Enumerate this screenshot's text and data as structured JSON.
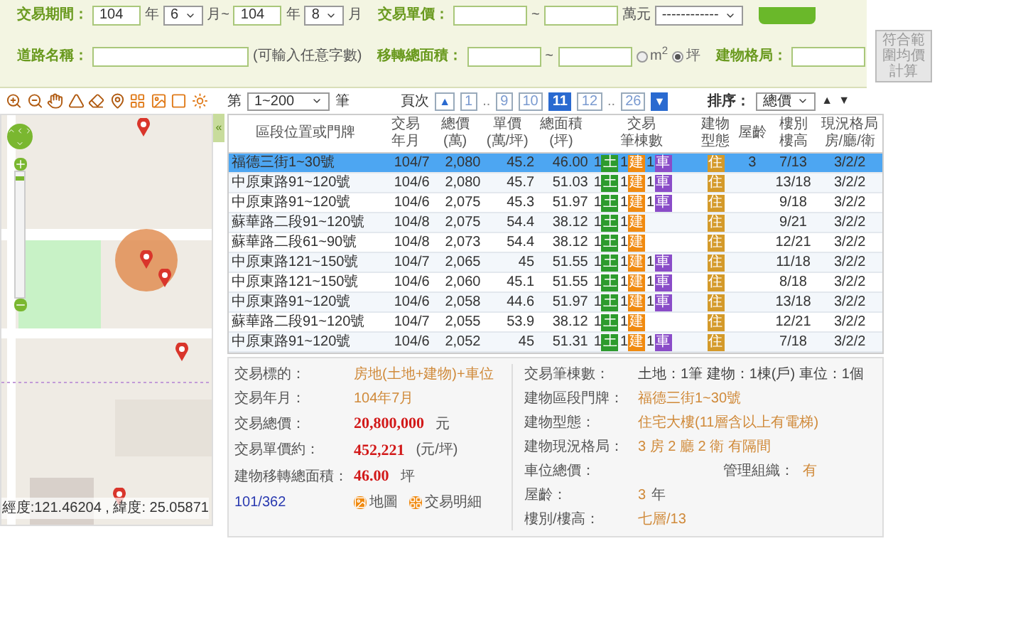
{
  "filters": {
    "trade_period": [
      {
        "kind": "label",
        "text": "交易期間："
      },
      {
        "kind": "short",
        "value": "104"
      },
      {
        "kind": "text",
        "text": "年"
      },
      {
        "kind": "select",
        "value": "6"
      },
      {
        "kind": "text",
        "text": "月~"
      },
      {
        "kind": "short",
        "value": "104"
      },
      {
        "kind": "text",
        "text": "年"
      },
      {
        "kind": "select",
        "value": "8"
      },
      {
        "kind": "text",
        "text": "月"
      }
    ],
    "unit_price": [
      {
        "kind": "label",
        "text": "交易單價："
      },
      {
        "kind": "field"
      },
      {
        "kind": "text",
        "text": "~"
      },
      {
        "kind": "field"
      },
      {
        "kind": "text",
        "text": "萬元"
      },
      {
        "kind": "select",
        "value": "------------"
      }
    ],
    "road_name": [
      {
        "kind": "label",
        "text": "道路名稱："
      },
      {
        "kind": "wide"
      },
      {
        "kind": "text",
        "text": "(可輸入任意字數)"
      }
    ],
    "total_area": [
      {
        "kind": "label",
        "text": "移轉總面積："
      },
      {
        "kind": "field"
      },
      {
        "kind": "text",
        "text": "~"
      },
      {
        "kind": "field"
      },
      {
        "kind": "radio",
        "text": "m$^{2}$",
        "selected": false
      },
      {
        "kind": "radio",
        "text": "坪",
        "selected": true
      }
    ],
    "layout": [
      {
        "kind": "label",
        "text": "建物格局："
      },
      {
        "kind": "field"
      },
      {
        "kind": "button",
        "text": "符合範圍均價計算"
      }
    ]
  },
  "pager": {
    "prefix": "第",
    "range": "1~200",
    "suffix": "筆",
    "page_label": "頁次",
    "prev": "▲",
    "next": "▼",
    "pages": [
      {
        "label": "1",
        "kind": "page",
        "selected": false
      },
      {
        "label": "..",
        "kind": "gap"
      },
      {
        "label": "9",
        "kind": "page",
        "selected": false
      },
      {
        "label": "10",
        "kind": "page",
        "selected": false
      },
      {
        "label": "11",
        "kind": "page",
        "selected": true
      },
      {
        "label": "12",
        "kind": "page",
        "selected": false
      },
      {
        "label": "..",
        "kind": "gap"
      },
      {
        "label": "26",
        "kind": "page",
        "selected": false
      }
    ],
    "sort_label": "排序：",
    "sort_value": "總價",
    "asc": "▲",
    "desc": "▼"
  },
  "collapse": "«",
  "map": {
    "zoom": {
      "level": 0.97
    },
    "coords": "經度:121.46204 , 緯度: 25.05871"
  },
  "table": {
    "columns": [
      [
        "區段位置或門牌"
      ],
      [
        "交易",
        "年月"
      ],
      [
        "總價",
        "(萬)"
      ],
      [
        "單價",
        "(萬/坪)"
      ],
      [
        "總面積",
        "(坪)"
      ],
      [
        "交易",
        "筆棟數"
      ],
      [
        "建物",
        "型態"
      ],
      [
        "屋齡"
      ],
      [
        "樓別",
        "樓高"
      ],
      [
        "現況格局",
        "房/廳/衛"
      ]
    ],
    "rows": [
      {
        "selected": true,
        "address": "福德三街1~30號",
        "date": "104/7",
        "total": "2,080",
        "price": "45.2",
        "area": "46.00",
        "counts": [
          {
            "kind": "land",
            "n": "1",
            "label": "土"
          },
          {
            "kind": "building",
            "n": "1",
            "label": "建"
          },
          {
            "kind": "parking",
            "n": "1",
            "label": "車"
          }
        ],
        "type": "住",
        "age": "3",
        "floor": "7/13",
        "layout": "3/2/2"
      },
      {
        "selected": false,
        "address": "中原東路91~120號",
        "date": "104/6",
        "total": "2,080",
        "price": "45.7",
        "area": "51.03",
        "counts": [
          {
            "kind": "land",
            "n": "1",
            "label": "土"
          },
          {
            "kind": "building",
            "n": "1",
            "label": "建"
          },
          {
            "kind": "parking",
            "n": "1",
            "label": "車"
          }
        ],
        "type": "住",
        "floor": "13/18",
        "layout": "3/2/2"
      },
      {
        "selected": false,
        "address": "中原東路91~120號",
        "date": "104/6",
        "total": "2,075",
        "price": "45.3",
        "area": "51.97",
        "counts": [
          {
            "kind": "land",
            "n": "1",
            "label": "土"
          },
          {
            "kind": "building",
            "n": "1",
            "label": "建"
          },
          {
            "kind": "parking",
            "n": "1",
            "label": "車"
          }
        ],
        "type": "住",
        "floor": "9/18",
        "layout": "3/2/2"
      },
      {
        "selected": false,
        "address": "蘇華路二段91~120號",
        "date": "104/8",
        "total": "2,075",
        "price": "54.4",
        "area": "38.12",
        "counts": [
          {
            "kind": "land",
            "n": "1",
            "label": "土"
          },
          {
            "kind": "building",
            "n": "1",
            "label": "建"
          }
        ],
        "type": "住",
        "floor": "9/21",
        "layout": "3/2/2"
      },
      {
        "selected": false,
        "address": "蘇華路二段61~90號",
        "date": "104/8",
        "total": "2,073",
        "price": "54.4",
        "area": "38.12",
        "counts": [
          {
            "kind": "land",
            "n": "1",
            "label": "土"
          },
          {
            "kind": "building",
            "n": "1",
            "label": "建"
          }
        ],
        "type": "住",
        "floor": "12/21",
        "layout": "3/2/2"
      },
      {
        "selected": false,
        "address": "中原東路121~150號",
        "date": "104/7",
        "total": "2,065",
        "price": "45",
        "area": "51.55",
        "counts": [
          {
            "kind": "land",
            "n": "1",
            "label": "土"
          },
          {
            "kind": "building",
            "n": "1",
            "label": "建"
          },
          {
            "kind": "parking",
            "n": "1",
            "label": "車"
          }
        ],
        "type": "住",
        "floor": "11/18",
        "layout": "3/2/2"
      },
      {
        "selected": false,
        "address": "中原東路121~150號",
        "date": "104/6",
        "total": "2,060",
        "price": "45.1",
        "area": "51.55",
        "counts": [
          {
            "kind": "land",
            "n": "1",
            "label": "土"
          },
          {
            "kind": "building",
            "n": "1",
            "label": "建"
          },
          {
            "kind": "parking",
            "n": "1",
            "label": "車"
          }
        ],
        "type": "住",
        "floor": "8/18",
        "layout": "3/2/2"
      },
      {
        "selected": false,
        "address": "中原東路91~120號",
        "date": "104/6",
        "total": "2,058",
        "price": "44.6",
        "area": "51.97",
        "counts": [
          {
            "kind": "land",
            "n": "1",
            "label": "土"
          },
          {
            "kind": "building",
            "n": "1",
            "label": "建"
          },
          {
            "kind": "parking",
            "n": "1",
            "label": "車"
          }
        ],
        "type": "住",
        "floor": "13/18",
        "layout": "3/2/2"
      },
      {
        "selected": false,
        "address": "蘇華路二段91~120號",
        "date": "104/7",
        "total": "2,055",
        "price": "53.9",
        "area": "38.12",
        "counts": [
          {
            "kind": "land",
            "n": "1",
            "label": "土"
          },
          {
            "kind": "building",
            "n": "1",
            "label": "建"
          }
        ],
        "type": "住",
        "floor": "12/21",
        "layout": "3/2/2"
      },
      {
        "selected": false,
        "address": "中原東路91~120號",
        "date": "104/6",
        "total": "2,052",
        "price": "45",
        "area": "51.31",
        "counts": [
          {
            "kind": "land",
            "n": "1",
            "label": "土"
          },
          {
            "kind": "building",
            "n": "1",
            "label": "建"
          },
          {
            "kind": "parking",
            "n": "1",
            "label": "車"
          }
        ],
        "type": "住",
        "floor": "7/18",
        "layout": "3/2/2"
      }
    ]
  },
  "detail": {
    "left": [
      {
        "label": "交易標的：",
        "value": "房地(土地+建物)+車位",
        "kind": "plain"
      },
      {
        "label": "交易年月：",
        "value": "104年7月",
        "kind": "plain"
      },
      {
        "label": "交易總價：",
        "value": "20,800,000",
        "unit": "元",
        "kind": "price"
      },
      {
        "label": "交易單價約：",
        "value": "452,221",
        "unit": "(元/坪)",
        "kind": "price"
      },
      {
        "label": "建物移轉總面積：",
        "value": "46.00",
        "unit": "坪",
        "kind": "price"
      }
    ],
    "counter": "101/362",
    "map_button": "地圖",
    "detail_button": "交易明細",
    "right": [
      {
        "label": "交易筆棟數：",
        "value": "土地：1筆 建物：1棟(戶) 車位：1個",
        "kind": "small"
      },
      {
        "label": "建物區段門牌：",
        "value": "福德三街1~30號",
        "kind": "plain"
      },
      {
        "label": "建物型態：",
        "value": "住宅大樓(11層含以上有電梯)",
        "kind": "plain"
      },
      {
        "label": "建物現況格局：",
        "value": "3 房 2 廳 2 衛 有隔間",
        "kind": "plain"
      },
      {
        "label": "車位總價：",
        "label2": "管理組織：",
        "value": "有",
        "kind": "pair"
      },
      {
        "label": "屋齡：",
        "value": "3",
        "unit": "年",
        "kind": "plain"
      },
      {
        "label": "樓別/樓高：",
        "value": "七層/13",
        "kind": "plain"
      }
    ]
  }
}
